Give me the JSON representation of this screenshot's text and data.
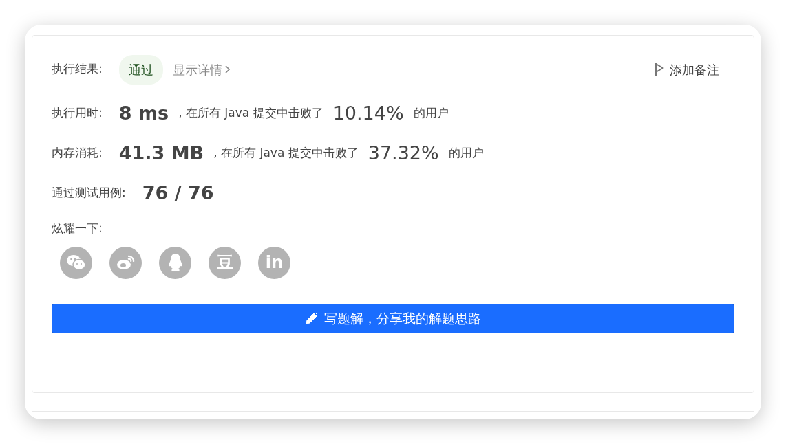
{
  "result": {
    "label": "执行结果:",
    "status": "通过",
    "details_link": "显示详情",
    "note_button": "添加备注"
  },
  "stats": [
    {
      "label": "执行用时:",
      "value": "8 ms",
      "text": ", 在所有 Java 提交中击败了",
      "percent": "10.14%",
      "suffix": "的用户"
    },
    {
      "label": "内存消耗:",
      "value": "41.3 MB",
      "text": ", 在所有 Java 提交中击败了",
      "percent": "37.32%",
      "suffix": "的用户"
    }
  ],
  "tests": {
    "label": "通过测试用例:",
    "value": "76 / 76"
  },
  "share": {
    "label": "炫耀一下:",
    "items": [
      {
        "kind": "wechat"
      },
      {
        "kind": "weibo"
      },
      {
        "kind": "qq"
      },
      {
        "kind": "glyph",
        "glyph": "豆"
      },
      {
        "kind": "glyph",
        "glyph": "in"
      }
    ]
  },
  "write_button": "写题解，分享我的解题思路"
}
